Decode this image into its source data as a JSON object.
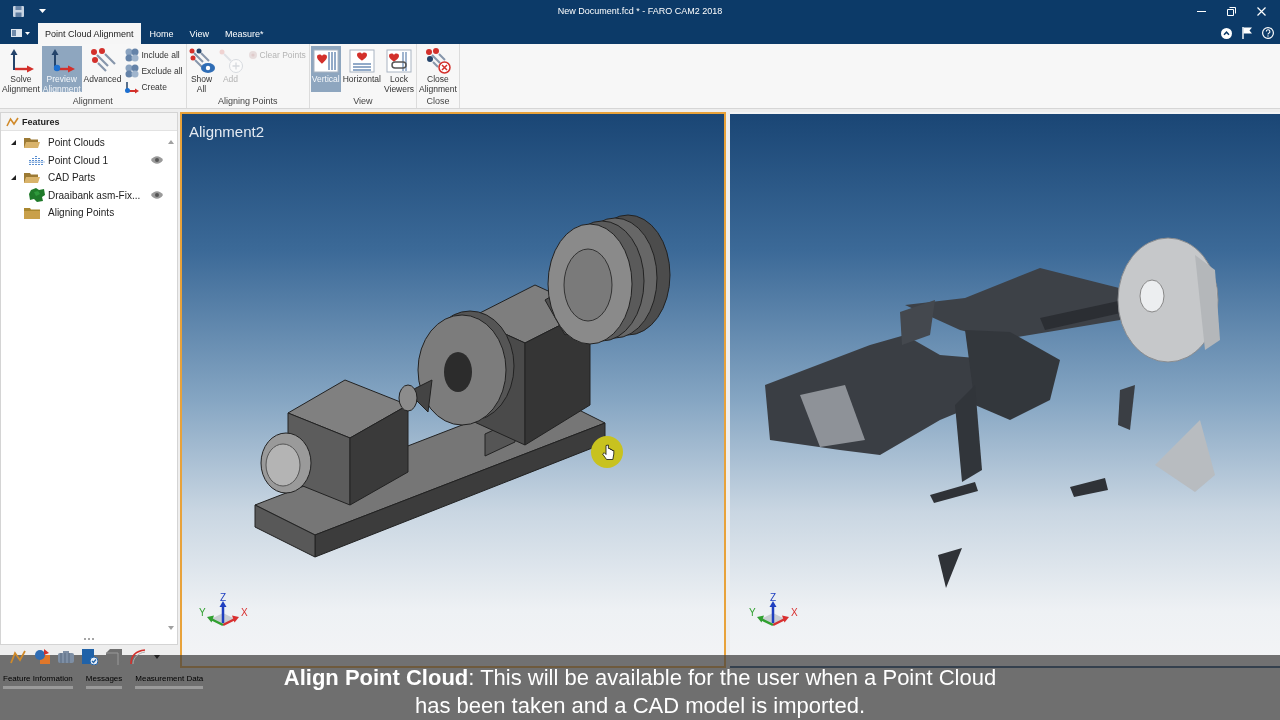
{
  "window": {
    "title": "New Document.fcd * - FARO CAM2 2018"
  },
  "ribbon_tabs": [
    {
      "label": "Point Cloud Alignment",
      "selected": true
    },
    {
      "label": "Home",
      "selected": false
    },
    {
      "label": "View",
      "selected": false
    },
    {
      "label": "Measure*",
      "selected": false
    }
  ],
  "ribbon_groups": [
    {
      "label": "Alignment",
      "buttons": [
        {
          "kind": "large",
          "label": "Solve Alignment",
          "selected": false,
          "disabled": false
        },
        {
          "kind": "large",
          "label": "Preview Alignment",
          "selected": true,
          "disabled": false
        },
        {
          "kind": "large",
          "label": "Advanced",
          "selected": false,
          "disabled": false
        },
        {
          "kind": "small",
          "label": "Include all",
          "selected": false,
          "disabled": false
        },
        {
          "kind": "small",
          "label": "Exclude all",
          "selected": false,
          "disabled": false
        },
        {
          "kind": "small",
          "label": "Create",
          "selected": false,
          "disabled": false
        }
      ]
    },
    {
      "label": "Aligning Points",
      "buttons": [
        {
          "kind": "large",
          "label": "Show All",
          "selected": false,
          "disabled": false
        },
        {
          "kind": "large",
          "label": "Add",
          "selected": false,
          "disabled": true
        },
        {
          "kind": "small",
          "label": "Clear Points",
          "selected": false,
          "disabled": true
        }
      ]
    },
    {
      "label": "View",
      "buttons": [
        {
          "kind": "large",
          "label": "Vertical",
          "selected": true,
          "disabled": false
        },
        {
          "kind": "large",
          "label": "Horizontal",
          "selected": false,
          "disabled": false
        },
        {
          "kind": "large",
          "label": "Lock Viewers",
          "selected": false,
          "disabled": false
        }
      ]
    },
    {
      "label": "Close",
      "buttons": [
        {
          "kind": "large",
          "label": "Close Alignment",
          "selected": false,
          "disabled": false
        }
      ]
    }
  ],
  "panel": {
    "title": "Features",
    "tree": [
      {
        "kind": "folder",
        "label": "Point Clouds",
        "expanded": true,
        "children": [
          {
            "kind": "point_cloud",
            "label": "Point Cloud 1",
            "visible": true
          }
        ]
      },
      {
        "kind": "folder",
        "label": "CAD Parts",
        "expanded": true,
        "children": [
          {
            "kind": "cad_part",
            "label": "Draaibank asm-Fix...",
            "visible": true
          }
        ]
      },
      {
        "kind": "folder",
        "label": "Aligning Points"
      }
    ]
  },
  "bottom_tabs": [
    {
      "label": "Feature Information"
    },
    {
      "label": "Messages"
    },
    {
      "label": "Measurement Data"
    }
  ],
  "viewports": [
    {
      "kind": "cad",
      "title": "Alignment2",
      "active": true,
      "axis_labels": [
        "Z",
        "Y",
        "X"
      ]
    },
    {
      "kind": "scan",
      "active": false,
      "axis_labels": [
        "Z",
        "Y",
        "X"
      ]
    }
  ],
  "caption": {
    "lines": [
      "**Align Point Cloud**: This will be available for the user when a Point Cloud",
      "has been taken and a CAD model is imported."
    ]
  }
}
